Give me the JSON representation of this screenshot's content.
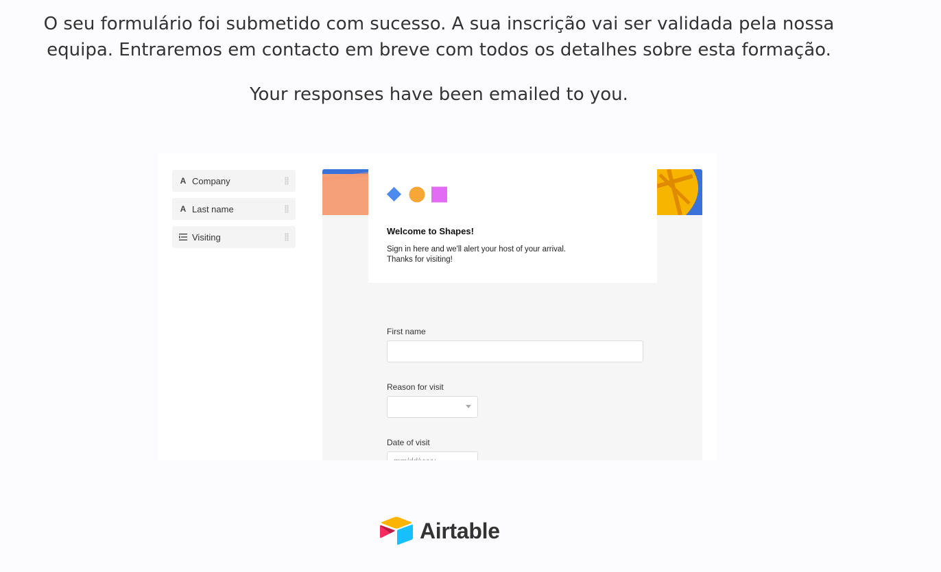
{
  "confirmation": {
    "message_pt_line1": "O seu formulário foi submetido com sucesso. A sua inscrição vai ser validada pela nossa",
    "message_pt_line2": "equipa. Entraremos em contacto em breve com todos os detalhes sobre esta formação.",
    "message_en": "Your responses have been emailed to you."
  },
  "preview": {
    "field_list": [
      {
        "label": "Company",
        "icon": "text-field-icon"
      },
      {
        "label": "Last name",
        "icon": "text-field-icon"
      },
      {
        "label": "Visiting",
        "icon": "linked-field-icon"
      }
    ],
    "form": {
      "title": "Welcome to Shapes!",
      "description_line1": "Sign in here and we'll alert your host of your arrival.",
      "description_line2": "Thanks for visiting!",
      "fields": [
        {
          "label": "First name",
          "type": "text",
          "value": ""
        },
        {
          "label": "Reason for visit",
          "type": "select",
          "value": ""
        },
        {
          "label": "Date of visit",
          "type": "date",
          "placeholder": "mm/dd/yyyy"
        }
      ]
    },
    "colors": {
      "banner_left": "#f6a07a",
      "banner_blue": "#3b72d9",
      "banner_yellow": "#f7b500",
      "shape_diamond": "#4d8af0",
      "shape_circle": "#f7a736",
      "shape_square": "#e36cf5"
    }
  },
  "footer": {
    "brand": "Airtable"
  }
}
